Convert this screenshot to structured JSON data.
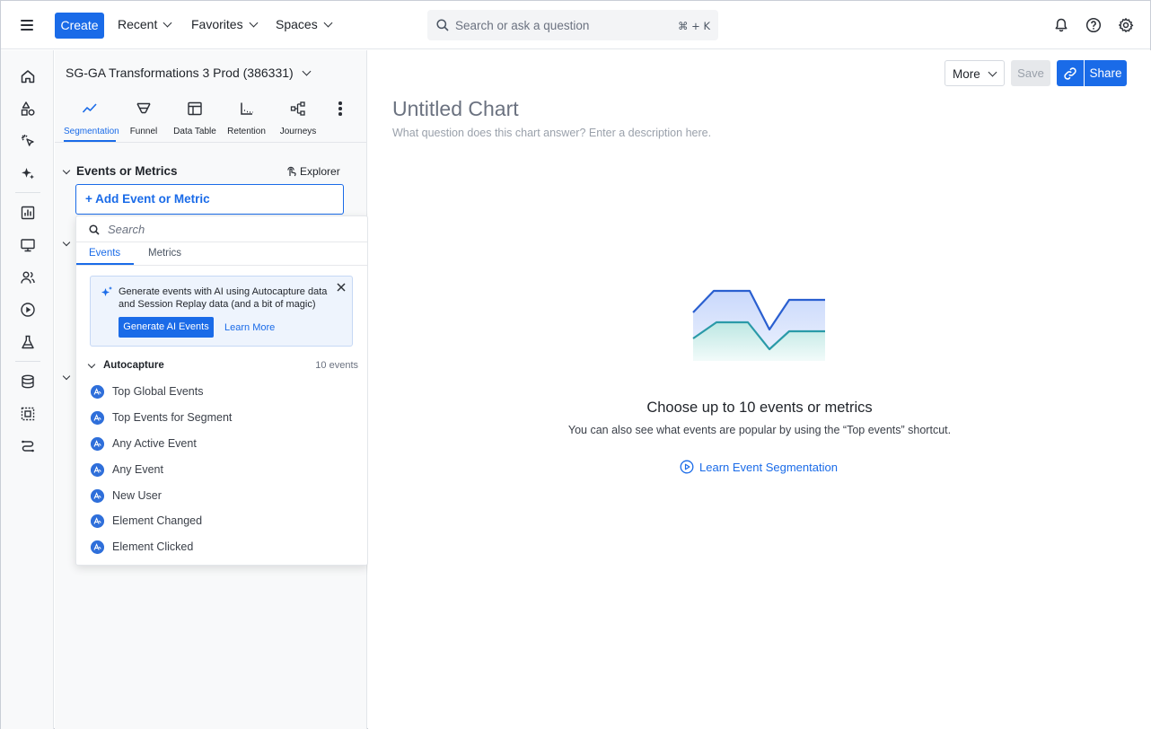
{
  "topbar": {
    "create_label": "Create",
    "nav": [
      {
        "label": "Recent"
      },
      {
        "label": "Favorites"
      },
      {
        "label": "Spaces"
      }
    ],
    "search_placeholder": "Search or ask a question",
    "search_shortcut": "⌘ + K",
    "icons": [
      "bell-icon",
      "help-icon",
      "settings-icon"
    ]
  },
  "rail": {
    "icons": [
      "home-icon",
      "shapes-icon",
      "cursor-click-icon",
      "sparkle-icon",
      "bar-chart-icon",
      "monitor-icon",
      "users-icon",
      "play-circle-icon",
      "flask-icon",
      "database-icon",
      "dotted-square-icon",
      "pipeline-icon"
    ]
  },
  "panel": {
    "project_name": "SG-GA Transformations 3 Prod (386331)",
    "chart_types": [
      {
        "label": "Segmentation",
        "icon": "segmentation-icon",
        "active": true
      },
      {
        "label": "Funnel",
        "icon": "funnel-icon",
        "active": false
      },
      {
        "label": "Data Table",
        "icon": "table-icon",
        "active": false
      },
      {
        "label": "Retention",
        "icon": "retention-icon",
        "active": false
      },
      {
        "label": "Journeys",
        "icon": "journeys-icon",
        "active": false
      }
    ],
    "section_title": "Events or Metrics",
    "explorer_label": "Explorer",
    "add_event_label": "+ Add Event or Metric"
  },
  "dropdown": {
    "search_placeholder": "Search",
    "tabs": [
      {
        "label": "Events",
        "active": true
      },
      {
        "label": "Metrics",
        "active": false
      }
    ],
    "ai_card": {
      "text": "Generate events with AI using Autocapture data and Session Replay data (and a bit of magic)",
      "button_label": "Generate AI Events",
      "link_label": "Learn More"
    },
    "group": {
      "title": "Autocapture",
      "count": "10 events"
    },
    "events": [
      {
        "label": "Top Global Events"
      },
      {
        "label": "Top Events for Segment"
      },
      {
        "label": "Any Active Event"
      },
      {
        "label": "Any Event"
      },
      {
        "label": "New User"
      },
      {
        "label": "Element Changed"
      },
      {
        "label": "Element Clicked"
      }
    ]
  },
  "main": {
    "more_label": "More",
    "save_label": "Save",
    "share_label": "Share",
    "chart_title": "Untitled Chart",
    "chart_description_placeholder": "What question does this chart answer? Enter a description here.",
    "empty_title": "Choose up to 10 events or metrics",
    "empty_subtitle": "You can also see what events are popular by using the “Top events” shortcut.",
    "learn_link": "Learn Event Segmentation"
  },
  "colors": {
    "accent": "#1a6be8",
    "event_icon": "#2f6fda",
    "illustration_top": "#2a5fd0",
    "illustration_bottom": "#2a9aa8"
  }
}
